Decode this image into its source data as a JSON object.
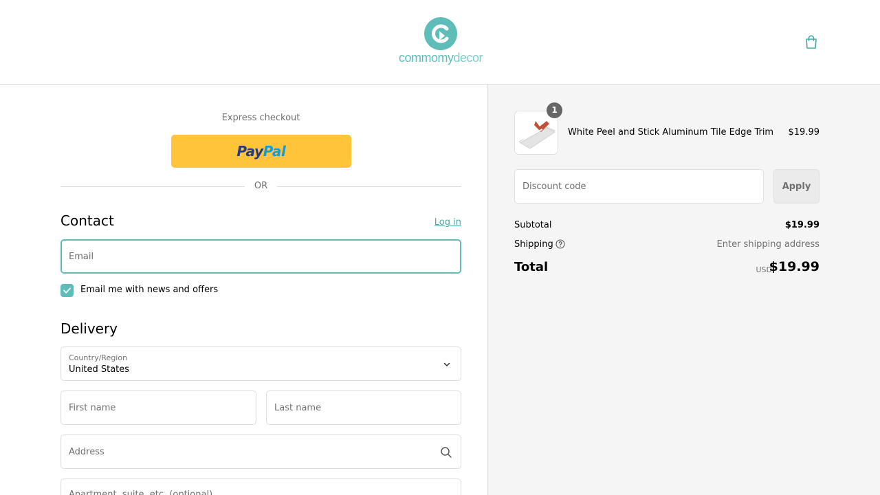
{
  "brand": {
    "name_part1": "commomy",
    "name_part2": "decor",
    "accent_color": "#5ebdb9"
  },
  "header": {
    "cart_icon": "shopping-bag-icon"
  },
  "express": {
    "label": "Express checkout",
    "paypal_pay": "Pay",
    "paypal_pal": "Pal",
    "divider": "OR"
  },
  "contact": {
    "title": "Contact",
    "login_link": "Log in",
    "email_placeholder": "Email",
    "newsletter_label": "Email me with news and offers",
    "newsletter_checked": true
  },
  "delivery": {
    "title": "Delivery",
    "country_label": "Country/Region",
    "country_value": "United States",
    "first_name_placeholder": "First name",
    "last_name_placeholder": "Last name",
    "address_placeholder": "Address",
    "apartment_placeholder": "Apartment, suite, etc. (optional)"
  },
  "summary": {
    "item": {
      "quantity": "1",
      "name": "White Peel and Stick Aluminum Tile Edge Trim",
      "price": "$19.99"
    },
    "discount_placeholder": "Discount code",
    "apply_label": "Apply",
    "subtotal_label": "Subtotal",
    "subtotal_value": "$19.99",
    "shipping_label": "Shipping",
    "shipping_value": "Enter shipping address",
    "total_label": "Total",
    "currency": "USD",
    "total_value": "$19.99"
  }
}
